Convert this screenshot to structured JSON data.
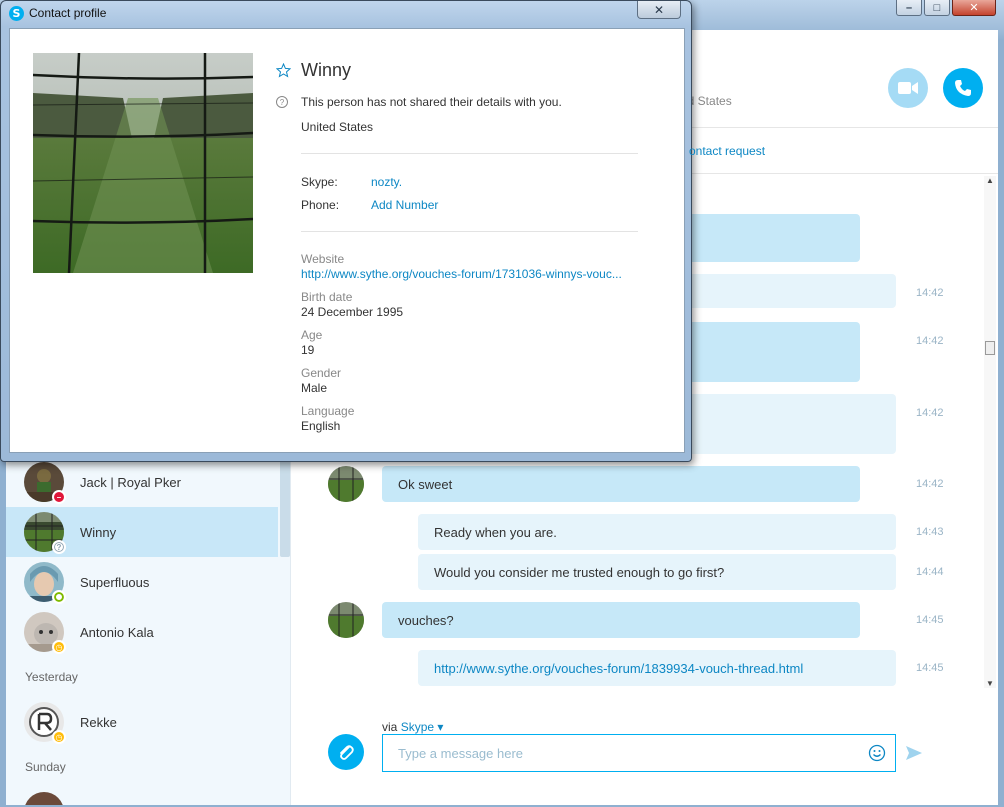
{
  "main_window": {
    "controls": [
      "–",
      "□",
      "✕"
    ]
  },
  "sidebar": {
    "contacts": [
      {
        "name": "Jack | Royal Pker",
        "status": "dnd"
      },
      {
        "name": "Winny",
        "status": "unknown",
        "active": true
      },
      {
        "name": "Superfluous",
        "status": "online"
      },
      {
        "name": "Antonio Kala",
        "status": "away"
      }
    ],
    "section_yesterday": "Yesterday",
    "yesterday_contacts": [
      {
        "name": "Rekke",
        "status": "away"
      }
    ],
    "section_sunday": "Sunday"
  },
  "chat": {
    "header_partial_location": "ed States",
    "contact_request_partial": "ontact request",
    "messages": [
      {
        "side": "in",
        "text": "Ok sweet",
        "time": "14:42"
      },
      {
        "side": "out",
        "text": "Ready when you are.",
        "time": "14:43"
      },
      {
        "side": "out",
        "text": "Would you consider me trusted enough to go first?",
        "time": "14:44"
      },
      {
        "side": "in",
        "text": "vouches?",
        "time": "14:45"
      },
      {
        "side": "out",
        "text": "http://www.sythe.org/vouches-forum/1839934-vouch-thread.html",
        "time": "14:45"
      }
    ],
    "hidden_times": [
      "14:42",
      "14:42",
      "14:42"
    ],
    "composer": {
      "via_prefix": "via",
      "via_network": "Skype",
      "placeholder": "Type a message here"
    }
  },
  "profile_dialog": {
    "title": "Contact profile",
    "close_label": "✕",
    "name": "Winny",
    "privacy_note": "This person has not shared their details with you.",
    "country": "United States",
    "skype_label": "Skype:",
    "skype_value": "nozty.",
    "phone_label": "Phone:",
    "phone_value": "Add Number",
    "website_label": "Website",
    "website_value": "http://www.sythe.org/vouches-forum/1731036-winnys-vouc...",
    "birth_label": "Birth date",
    "birth_value": "24 December 1995",
    "age_label": "Age",
    "age_value": "19",
    "gender_label": "Gender",
    "gender_value": "Male",
    "language_label": "Language",
    "language_value": "English"
  },
  "colors": {
    "accent": "#00aff0",
    "bubble_in": "#c6e8f8",
    "bubble_out": "#e6f4fb",
    "link": "#0d87c4"
  }
}
